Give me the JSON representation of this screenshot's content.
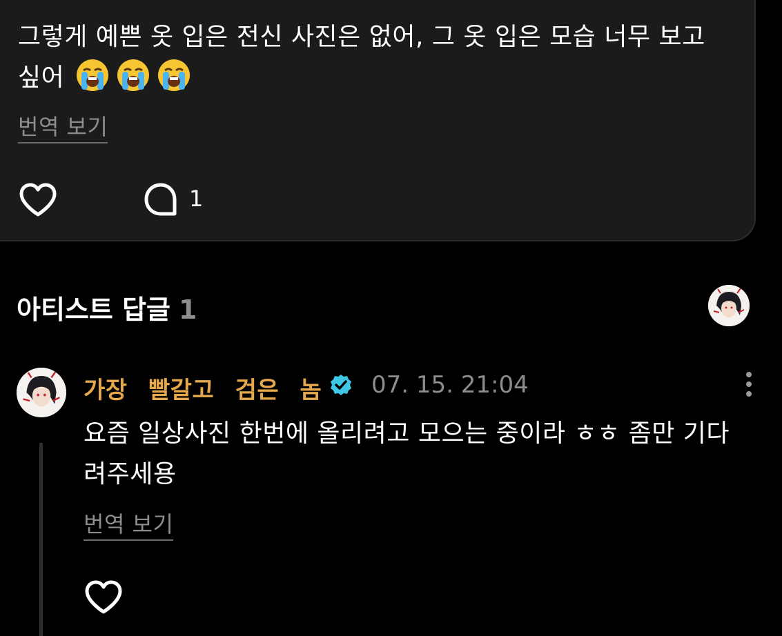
{
  "post": {
    "text": "그렇게 예쁜 옷 입은 전신 사진은 없어, 그 옷 입은 모습 너무 보고 싶어",
    "emojis": [
      "loudly-crying-face",
      "loudly-crying-face",
      "loudly-crying-face"
    ],
    "translate_label": "번역 보기",
    "comment_count": "1"
  },
  "artist_replies": {
    "title": "아티스트 답글",
    "count": "1"
  },
  "reply": {
    "author": "가장 빨갈고 검은 놈",
    "timestamp": "07. 15. 21:04",
    "text": "요즘 일상사진 한번에 올리려고 모으는 중이라 ㅎㅎ 좀만 기다려주세용",
    "translate_label": "번역 보기"
  },
  "colors": {
    "background": "#000000",
    "card": "#1b1b1b",
    "author": "#e5a84a",
    "muted": "#8d8d8d",
    "verified": "#3fc8e6"
  }
}
